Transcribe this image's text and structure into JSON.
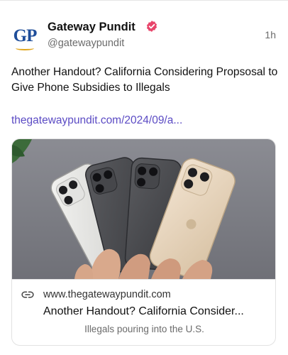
{
  "post": {
    "author_name": "Gateway Pundit",
    "avatar_text": "GP",
    "handle": "@gatewaypundit",
    "timestamp": "1h",
    "text": "Another Handout? California Considering Propsosal to Give Phone Subsidies to Illegals",
    "link_text": "thegatewaypundit.com/2024/09/a..."
  },
  "link_card": {
    "domain": "www.thegatewaypundit.com",
    "title": "Another Handout? California Consider...",
    "description": "Illegals pouring into the U.S.",
    "image_subject": "hands holding four iPhones"
  },
  "icons": {
    "verified": "verified-badge-icon",
    "link": "link-icon"
  },
  "colors": {
    "brand_blue": "#1f4e9a",
    "brand_gold": "#e0a51c",
    "link": "#5b4bc4",
    "verified_badge": "#e8456b",
    "muted_text": "#6b6b6b"
  }
}
